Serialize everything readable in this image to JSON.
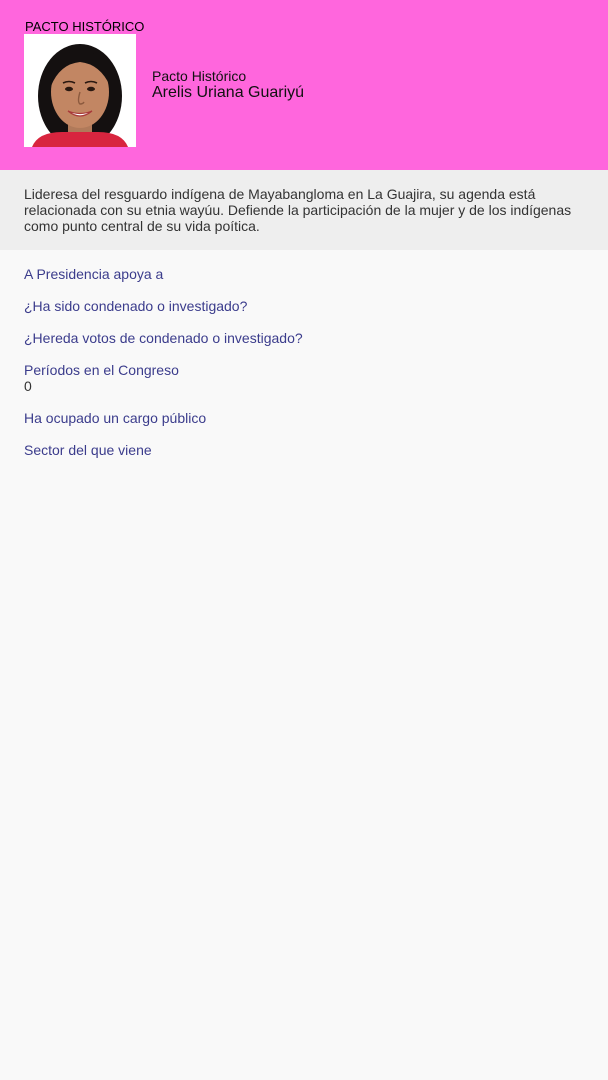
{
  "header": {
    "party_tag": "PACTO HISTÓRICO",
    "party_name": "Pacto Histórico",
    "candidate_name": "Arelis Uriana Guariyú",
    "background_color": "#ff66dd",
    "photo_icon": "candidate-photo"
  },
  "bio": {
    "text": "Lideresa del resguardo indígena de Mayabangloma en La Guajira, su agenda está relacionada con su etnia wayúu. Defiende la participación de la mujer y de los indígenas como punto central de su vida poítica."
  },
  "facts": {
    "presidency_support": {
      "label": "A Presidencia apoya a",
      "value": ""
    },
    "convicted": {
      "label": "¿Ha sido condenado o investigado?",
      "value": ""
    },
    "inherits_votes": {
      "label": "¿Hereda votos de condenado o investigado?",
      "value": ""
    },
    "congress_periods": {
      "label": "Períodos en el Congreso",
      "value": "0"
    },
    "public_office": {
      "label": "Ha ocupado un cargo público",
      "value": ""
    },
    "sector": {
      "label": "Sector del que viene",
      "value": ""
    }
  },
  "colors": {
    "label_color": "#3b3c8c",
    "bio_background": "#eeeeee",
    "page_background": "#f9f9f9"
  }
}
